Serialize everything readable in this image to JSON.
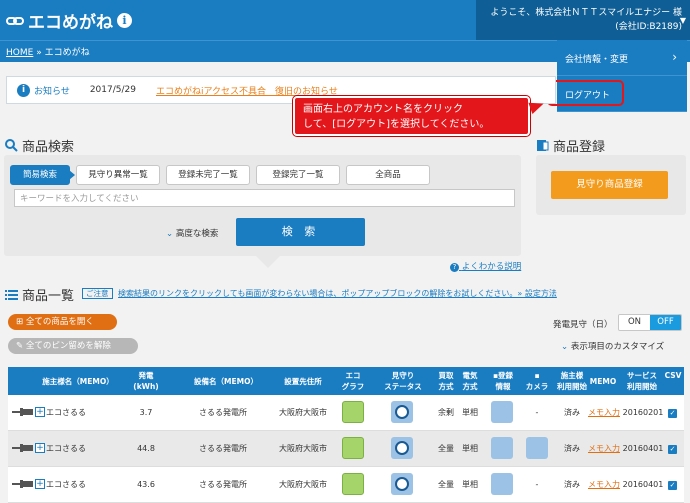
{
  "header": {
    "logo_text": "エコめがね",
    "info_glyph": "i",
    "account_line1": "ようこそ、株式会社ＮＴＴスマイルエナジー 様",
    "account_line2": "(会社ID:B2189)"
  },
  "breadcrumb": {
    "home": "HOME",
    "sep": "»",
    "current": "エコめがね"
  },
  "account_menu": {
    "items": [
      {
        "label": "会社情報・変更"
      },
      {
        "label": "ログアウト"
      }
    ]
  },
  "notice": {
    "label": "お知らせ",
    "date": "2017/5/29",
    "link": "エコめがねiアクセス不具合　復旧のお知らせ"
  },
  "callout": {
    "line1": "画面右上のアカウント名をクリック",
    "line2": "して、[ログアウト]を選択してください。"
  },
  "search": {
    "title": "商品検索",
    "tabs": [
      "簡易検索",
      "見守り異常一覧",
      "登録未完了一覧",
      "登録完了一覧",
      "全商品"
    ],
    "placeholder": "キーワードを入力してください",
    "advanced": "高度な検索",
    "button": "検 索",
    "faq": "よくわかる説明"
  },
  "register": {
    "title": "商品登録",
    "button": "見守り商品登録"
  },
  "list": {
    "title": "商品一覧",
    "caution_tag": "ご注意",
    "caution_text": "検索結果のリンクをクリックしても画面が変わらない場合は、ポップアップブロックの解除をお試しください。» 設定方法",
    "open_all": "全ての商品を開く",
    "unpin_all": "全てのピン留めを解除",
    "gen_label": "発電見守（日）",
    "toggle_on": "ON",
    "toggle_off": "OFF",
    "customize": "表示項目のカスタマイズ",
    "headers": {
      "owner": "施主様名（MEMO）",
      "gen_a": "発電",
      "gen_b": "(kWh)",
      "facility": "設備名（MEMO）",
      "location": "設置先住所",
      "eco_a": "エコ",
      "eco_b": "グラフ",
      "watch_a": "見守り",
      "watch_b": "ステータス",
      "buy_a": "買取",
      "buy_b": "方式",
      "power_a": "電気",
      "power_b": "方式",
      "reg_a": "登録",
      "reg_b": "情報",
      "camera": "カメラ",
      "use_a": "施主様",
      "use_b": "利用開始",
      "memo": "MEMO",
      "svc_a": "サービス",
      "svc_b": "利用開始",
      "csv": "CSV"
    },
    "rows": [
      {
        "owner": "エコさるる",
        "gen": "3.7",
        "facility": "さるる発電所",
        "location": "大阪府大阪市",
        "buy": "余剰",
        "power": "単相",
        "camera": "-",
        "use": "済み",
        "memo": "メモ入力",
        "svc": "20160201",
        "has_camera": false
      },
      {
        "owner": "エコさるる",
        "gen": "44.8",
        "facility": "さるる発電所",
        "location": "大阪府大阪市",
        "buy": "全量",
        "power": "単相",
        "camera": "",
        "use": "済み",
        "memo": "メモ入力",
        "svc": "20160401",
        "has_camera": true
      },
      {
        "owner": "エコさるる",
        "gen": "43.6",
        "facility": "さるる発電所",
        "location": "大阪府大阪市",
        "buy": "全量",
        "power": "単相",
        "camera": "-",
        "use": "済み",
        "memo": "メモ入力",
        "svc": "20160401",
        "has_camera": false
      }
    ]
  },
  "colors": {
    "brand": "#1a7cc1",
    "accent_orange": "#f39b1c",
    "alert_red": "#e3171b"
  }
}
